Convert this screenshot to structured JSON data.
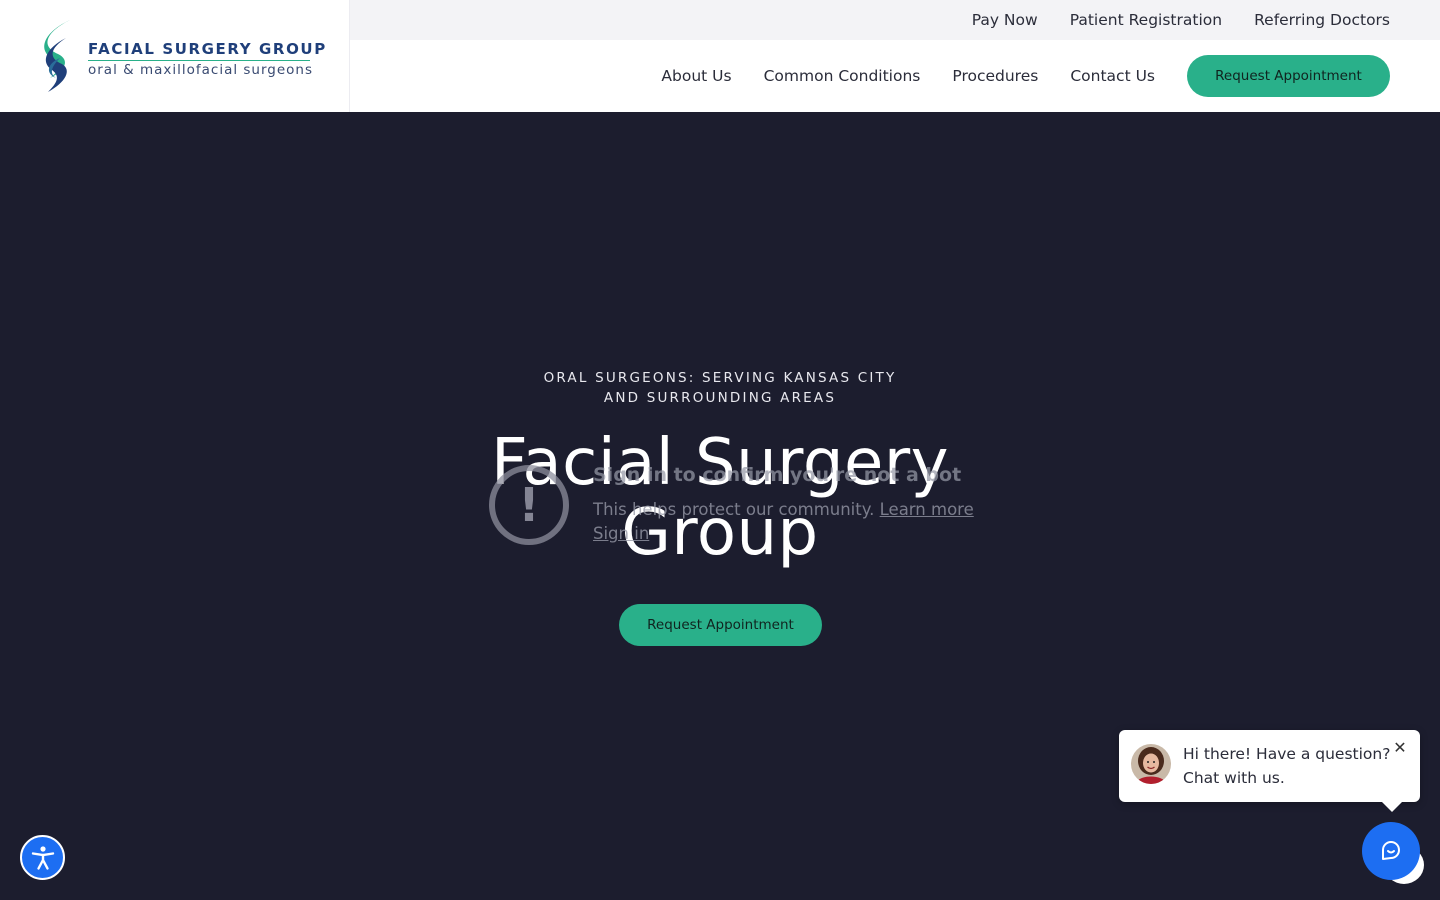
{
  "brand": {
    "name": "FACIAL SURGERY GROUP",
    "tagline": "oral & maxillofacial surgeons",
    "colors": {
      "navy": "#1f3f7a",
      "green": "#29b08a",
      "hero_bg": "#1c1d2e",
      "chat_blue": "#1d6ef2"
    }
  },
  "topbar": {
    "links": [
      {
        "label": "Pay Now"
      },
      {
        "label": "Patient Registration"
      },
      {
        "label": "Referring Doctors"
      }
    ]
  },
  "nav": {
    "links": [
      {
        "label": "About Us"
      },
      {
        "label": "Common Conditions"
      },
      {
        "label": "Procedures"
      },
      {
        "label": "Contact Us"
      }
    ],
    "cta_label": "Request Appointment"
  },
  "hero": {
    "eyebrow_line1": "ORAL SURGEONS: SERVING KANSAS CITY",
    "eyebrow_line2": "AND SURROUNDING AREAS",
    "title_line1": "Facial Surgery",
    "title_line2": "Group",
    "cta_label": "Request Appointment"
  },
  "bot_check": {
    "icon": "exclamation-icon",
    "heading": "Sign in to confirm you're not a bot",
    "body": "This helps protect our community.",
    "learn_more": "Learn more",
    "sign_in": "Sign in"
  },
  "chat": {
    "line1": "Hi there! Have a question?",
    "line2": "Chat with us.",
    "close_icon": "close-icon",
    "launcher_icon": "chat-icon"
  },
  "accessibility": {
    "icon": "accessibility-icon"
  }
}
